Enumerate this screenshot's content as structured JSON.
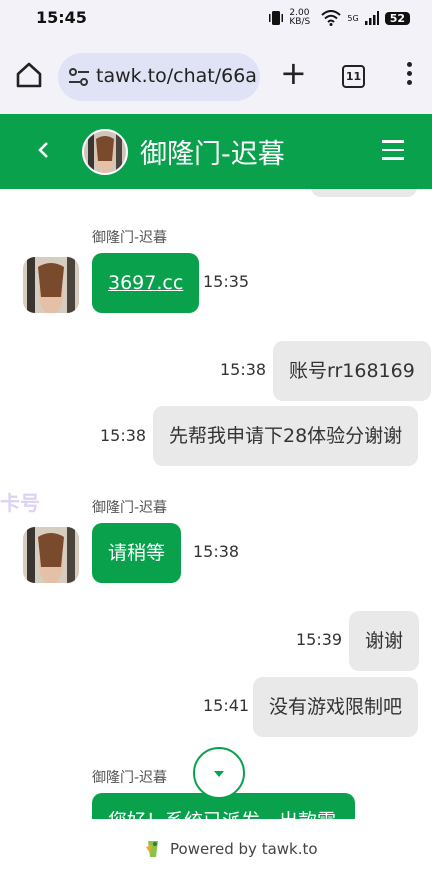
{
  "status_bar": {
    "time": "15:45",
    "net_speed": "2.00 KB/S",
    "signal": "5G",
    "battery": "52"
  },
  "browser": {
    "url": "tawk.to/chat/66a",
    "tab_count": "11"
  },
  "header": {
    "title": "御隆门-迟暮"
  },
  "watermark": "卡号",
  "messages": [
    {
      "side": "visitor",
      "text": "",
      "time": ""
    },
    {
      "side": "agent",
      "sender": "御隆门-迟暮",
      "text": "3697.cc",
      "is_link": true,
      "time": "15:35"
    },
    {
      "side": "visitor",
      "text": "账号rr168169",
      "time": "15:38"
    },
    {
      "side": "visitor",
      "text": "先帮我申请下28体验分谢谢",
      "time": "15:38"
    },
    {
      "side": "agent",
      "sender": "御隆门-迟暮",
      "text": "请稍等",
      "time": "15:38"
    },
    {
      "side": "visitor",
      "text": "谢谢",
      "time": "15:39"
    },
    {
      "side": "visitor",
      "text": "没有游戏限制吧",
      "time": "15:41"
    },
    {
      "side": "agent",
      "sender": "御隆门-迟暮",
      "text": "您好！系统已派发，出款需",
      "time": ""
    }
  ],
  "footer": {
    "text": "Powered by tawk.to"
  },
  "colors": {
    "brand_green": "#0aa14d",
    "visitor_bubble": "#e9e9e9",
    "browser_bar": "#f3f2f8"
  }
}
